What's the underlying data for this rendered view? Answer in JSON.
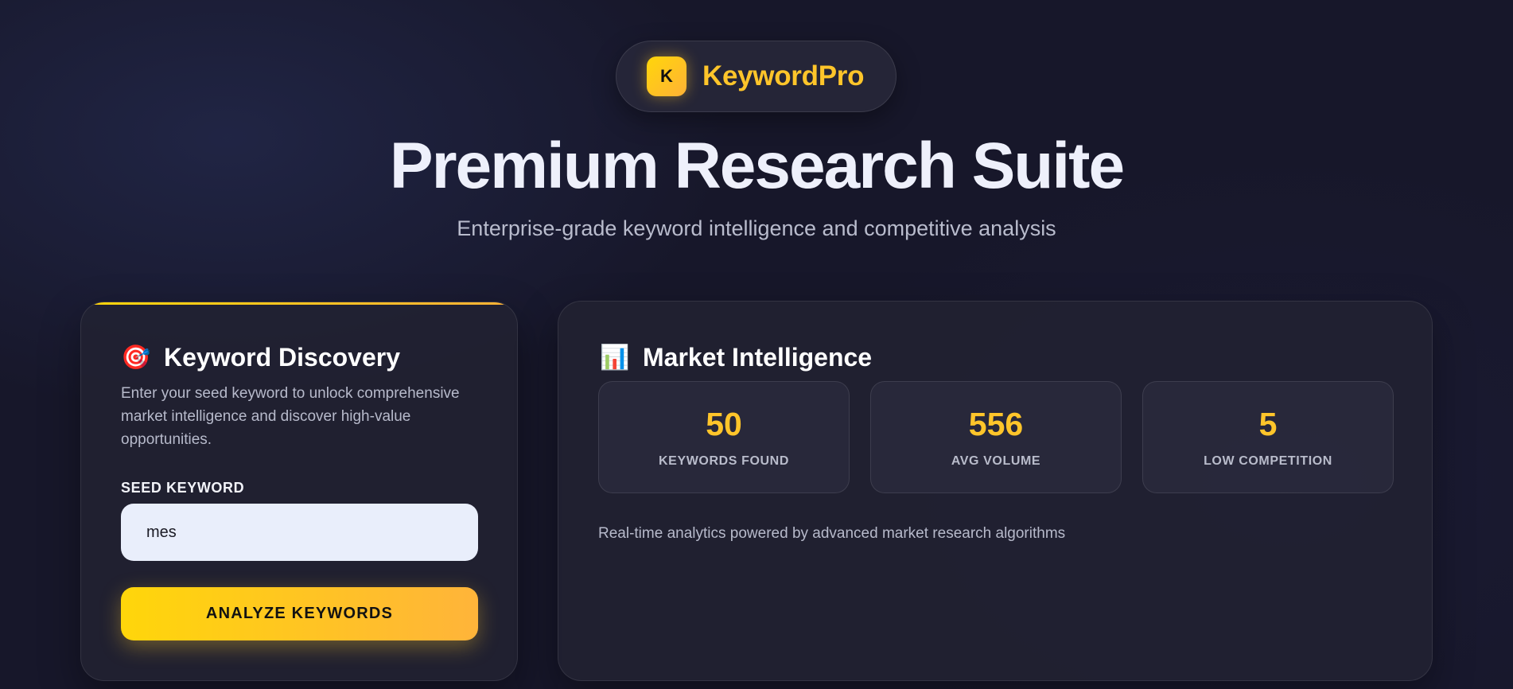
{
  "brand": {
    "logo_letter": "K",
    "name": "KeywordPro"
  },
  "hero": {
    "title": "Premium Research Suite",
    "subtitle": "Enterprise-grade keyword intelligence and competitive analysis"
  },
  "discovery": {
    "icon": "target-icon",
    "emoji": "🎯",
    "title": "Keyword Discovery",
    "description": "Enter your seed keyword to unlock comprehensive market intelligence and discover high-value opportunities.",
    "field_label": "SEED KEYWORD",
    "input_value": "mes",
    "button_label": "ANALYZE KEYWORDS"
  },
  "intelligence": {
    "icon": "bar-chart-icon",
    "emoji": "📊",
    "title": "Market Intelligence",
    "stats": [
      {
        "value": "50",
        "label": "KEYWORDS FOUND"
      },
      {
        "value": "556",
        "label": "AVG VOLUME"
      },
      {
        "value": "5",
        "label": "LOW COMPETITION"
      }
    ],
    "footnote": "Real-time analytics powered by advanced market research algorithms"
  },
  "colors": {
    "accent": "#ffc52a",
    "background": "#17172a",
    "card": "#222232"
  }
}
